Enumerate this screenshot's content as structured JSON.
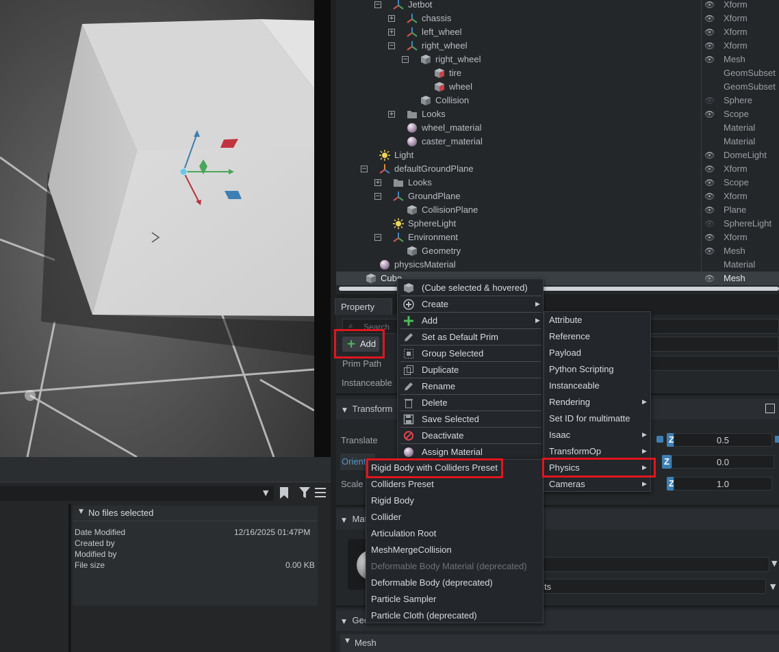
{
  "stage": {
    "rows": [
      {
        "name": "Jetbot",
        "type": "Xform",
        "indent": 3,
        "exp": "-",
        "icon": "xform",
        "eye": true
      },
      {
        "name": "chassis",
        "type": "Xform",
        "indent": 4,
        "exp": "+",
        "icon": "xform",
        "eye": true
      },
      {
        "name": "left_wheel",
        "type": "Xform",
        "indent": 4,
        "exp": "+",
        "icon": "xform",
        "eye": true
      },
      {
        "name": "right_wheel",
        "type": "Xform",
        "indent": 4,
        "exp": "-",
        "icon": "xform",
        "eye": true
      },
      {
        "name": "right_wheel",
        "type": "Mesh",
        "indent": 5,
        "exp": "-",
        "icon": "mesh",
        "eye": true
      },
      {
        "name": "tire",
        "type": "GeomSubset",
        "indent": 6,
        "exp": "",
        "icon": "subset",
        "eye": false
      },
      {
        "name": "wheel",
        "type": "GeomSubset",
        "indent": 6,
        "exp": "",
        "icon": "subset",
        "eye": false
      },
      {
        "name": "Collision",
        "type": "Sphere",
        "indent": 5,
        "exp": "",
        "icon": "mesh",
        "eye": "dim"
      },
      {
        "name": "Looks",
        "type": "Scope",
        "indent": 4,
        "exp": "+",
        "icon": "folder",
        "eye": true
      },
      {
        "name": "wheel_material",
        "type": "Material",
        "indent": 4,
        "exp": "",
        "icon": "material",
        "eye": false
      },
      {
        "name": "caster_material",
        "type": "Material",
        "indent": 4,
        "exp": "",
        "icon": "material",
        "eye": false
      },
      {
        "name": "Light",
        "type": "DomeLight",
        "indent": 2,
        "exp": "",
        "icon": "light",
        "eye": true
      },
      {
        "name": "defaultGroundPlane",
        "type": "Xform",
        "indent": 2,
        "exp": "-",
        "icon": "xformo",
        "eye": true
      },
      {
        "name": "Looks",
        "type": "Scope",
        "indent": 3,
        "exp": "+",
        "icon": "folder",
        "eye": true
      },
      {
        "name": "GroundPlane",
        "type": "Xform",
        "indent": 3,
        "exp": "-",
        "icon": "xform",
        "eye": true
      },
      {
        "name": "CollisionPlane",
        "type": "Plane",
        "indent": 4,
        "exp": "",
        "icon": "mesh",
        "eye": true
      },
      {
        "name": "SphereLight",
        "type": "SphereLight",
        "indent": 3,
        "exp": "",
        "icon": "light",
        "eye": "dim"
      },
      {
        "name": "Environment",
        "type": "Xform",
        "indent": 3,
        "exp": "-",
        "icon": "xform",
        "eye": true
      },
      {
        "name": "Geometry",
        "type": "Mesh",
        "indent": 4,
        "exp": "",
        "icon": "mesh",
        "eye": true
      },
      {
        "name": "physicsMaterial",
        "type": "Material",
        "indent": 2,
        "exp": "",
        "icon": "material",
        "eye": false
      },
      {
        "name": "Cube",
        "type": "Mesh",
        "indent": 1,
        "exp": "",
        "icon": "mesh",
        "eye": true
      }
    ]
  },
  "property": {
    "tab": "Property",
    "search_placeholder": "Search",
    "add_label": "Add",
    "prim_path_label": "Prim Path",
    "instanceable_label": "Instanceable",
    "transform_label": "Transform",
    "translate_label": "Translate",
    "orient_label": "Orient",
    "scale_label": "Scale",
    "translate_z": "0.5",
    "orient_z": "0.0",
    "scale_z": "1.0",
    "material_label": "Mat",
    "material_tail": "ts",
    "geometry_label": "Geo",
    "mesh_label": "Mesh"
  },
  "content": {
    "no_files": "No files selected",
    "date_modified_label": "Date Modified",
    "date_modified_value": "12/16/2025 01:47PM",
    "created_by_label": "Created by",
    "modified_by_label": "Modified by",
    "file_size_label": "File size",
    "file_size_value": "0.00 KB"
  },
  "context_menu": {
    "items": [
      {
        "label": "(Cube selected & hovered)",
        "icon": "cube-icon",
        "submenu": false
      },
      {
        "label": "Create",
        "icon": "plus-circle-icon",
        "submenu": true
      },
      {
        "label": "Add",
        "icon": "plus-icon",
        "submenu": true
      },
      {
        "label": "Set as Default Prim",
        "icon": "pencil-icon",
        "submenu": false
      },
      {
        "label": "Group Selected",
        "icon": "group-icon",
        "submenu": false
      },
      {
        "label": "Duplicate",
        "icon": "duplicate-icon",
        "submenu": false
      },
      {
        "label": "Rename",
        "icon": "pencil-icon",
        "submenu": false
      },
      {
        "label": "Delete",
        "icon": "trash-icon",
        "submenu": false
      },
      {
        "label": "Save Selected",
        "icon": "save-icon",
        "submenu": false
      },
      {
        "label": "Deactivate",
        "icon": "deactivate-icon",
        "submenu": false
      },
      {
        "label": "Assign Material",
        "icon": "material-icon",
        "submenu": false
      }
    ]
  },
  "add_menu": {
    "items": [
      {
        "label": "Attribute",
        "submenu": false
      },
      {
        "label": "Reference",
        "submenu": false
      },
      {
        "label": "Payload",
        "submenu": false
      },
      {
        "label": "Python Scripting",
        "submenu": false
      },
      {
        "label": "Instanceable",
        "submenu": false
      },
      {
        "label": "Rendering",
        "submenu": true
      },
      {
        "label": "Set ID for multimatte",
        "submenu": false
      },
      {
        "label": "Isaac",
        "submenu": true
      },
      {
        "label": "TransformOp",
        "submenu": true
      },
      {
        "label": "Physics",
        "submenu": true
      },
      {
        "label": "Cameras",
        "submenu": true
      }
    ]
  },
  "physics_menu": {
    "items": [
      {
        "label": "Rigid Body with Colliders Preset",
        "disabled": false
      },
      {
        "label": "Colliders Preset",
        "disabled": false
      },
      {
        "label": "Rigid Body",
        "disabled": false
      },
      {
        "label": "Collider",
        "disabled": false
      },
      {
        "label": "Articulation Root",
        "disabled": false
      },
      {
        "label": "MeshMergeCollision",
        "disabled": false
      },
      {
        "label": "Deformable Body Material (deprecated)",
        "disabled": true
      },
      {
        "label": "Deformable Body (deprecated)",
        "disabled": false
      },
      {
        "label": "Particle Sampler",
        "disabled": false
      },
      {
        "label": "Particle Cloth (deprecated)",
        "disabled": false
      }
    ]
  },
  "colors": {
    "highlight_red": "#e0161d",
    "axis_x": "#b8323a",
    "axis_y": "#4aa55a",
    "axis_z": "#3d7fb3"
  }
}
